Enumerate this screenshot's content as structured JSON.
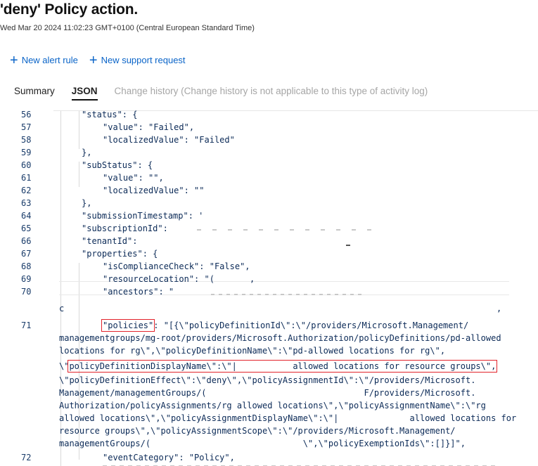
{
  "header": {
    "title": "'deny' Policy action.",
    "subtitle": "Wed Mar 20 2024 11:02:23 GMT+0100 (Central European Standard Time)"
  },
  "commands": {
    "new_alert_rule": "New alert rule",
    "new_support_request": "New support request"
  },
  "tabs": {
    "summary": "Summary",
    "json": "JSON",
    "change_history": "Change history (Change history is not applicable to this type of activity log)"
  },
  "editor": {
    "lines": [
      {
        "n": "56",
        "text": "\"status\": {"
      },
      {
        "n": "57",
        "text": "\"value\": \"Failed\","
      },
      {
        "n": "58",
        "text": "\"localizedValue\": \"Failed\""
      },
      {
        "n": "59",
        "text": "},"
      },
      {
        "n": "60",
        "text": "\"subStatus\": {"
      },
      {
        "n": "61",
        "text": "\"value\": \"\","
      },
      {
        "n": "62",
        "text": "\"localizedValue\": \"\""
      },
      {
        "n": "63",
        "text": "},"
      },
      {
        "n": "64",
        "text": "\"submissionTimestamp\": '"
      },
      {
        "n": "65",
        "text": "\"subscriptionId\":"
      },
      {
        "n": "66",
        "text": "\"tenantId\":"
      },
      {
        "n": "67",
        "text": "\"properties\": {"
      },
      {
        "n": "68",
        "text": "\"isComplianceCheck\": \"False\","
      },
      {
        "n": "69",
        "text": "\"resourceLocation\": \"("
      },
      {
        "n": "70",
        "text": "\"ancestors\": \""
      },
      {
        "n": "",
        "text": "c"
      },
      {
        "n": "71",
        "key": "\"policies\"",
        "text": ": \"[{\\\"policyDefinitionId\\\":\\\"/providers/Microsoft.Management/"
      },
      {
        "n": "",
        "text": "managementgroups/mg-root/providers/Microsoft.Authorization/policyDefinitions/pd-allowed"
      },
      {
        "n": "",
        "text": "locations for rg\\\",\\\"policyDefinitionName\\\":\\\"pd-allowed locations for rg\\\","
      },
      {
        "n": "",
        "prefix": "\\\"",
        "boxed": "policyDefinitionDisplayName\\\":\\\"|           allowed locations for resource groups\\\",",
        "text": ""
      },
      {
        "n": "",
        "text": "\\\"policyDefinitionEffect\\\":\\\"deny\\\",\\\"policyAssignmentId\\\":\\\"/providers/Microsoft."
      },
      {
        "n": "",
        "text": "Management/managementGroups/(                               F/providers/Microsoft."
      },
      {
        "n": "",
        "text": "Authorization/policyAssignments/rg allowed locations\\\",\\\"policyAssignmentName\\\":\\\"rg"
      },
      {
        "n": "",
        "text": "allowed locations\\\",\\\"policyAssignmentDisplayName\\\":\\\"|              allowed locations for"
      },
      {
        "n": "",
        "text": "resource groups\\\",\\\"policyAssignmentScope\\\":\\\"/providers/Microsoft.Management/"
      },
      {
        "n": "",
        "text": "managementGroups/(                              \\\",\\\"policyExemptionIds\\\":[]}]\","
      },
      {
        "n": "72",
        "text": "\"eventCategory\": \"Policy\","
      }
    ]
  }
}
